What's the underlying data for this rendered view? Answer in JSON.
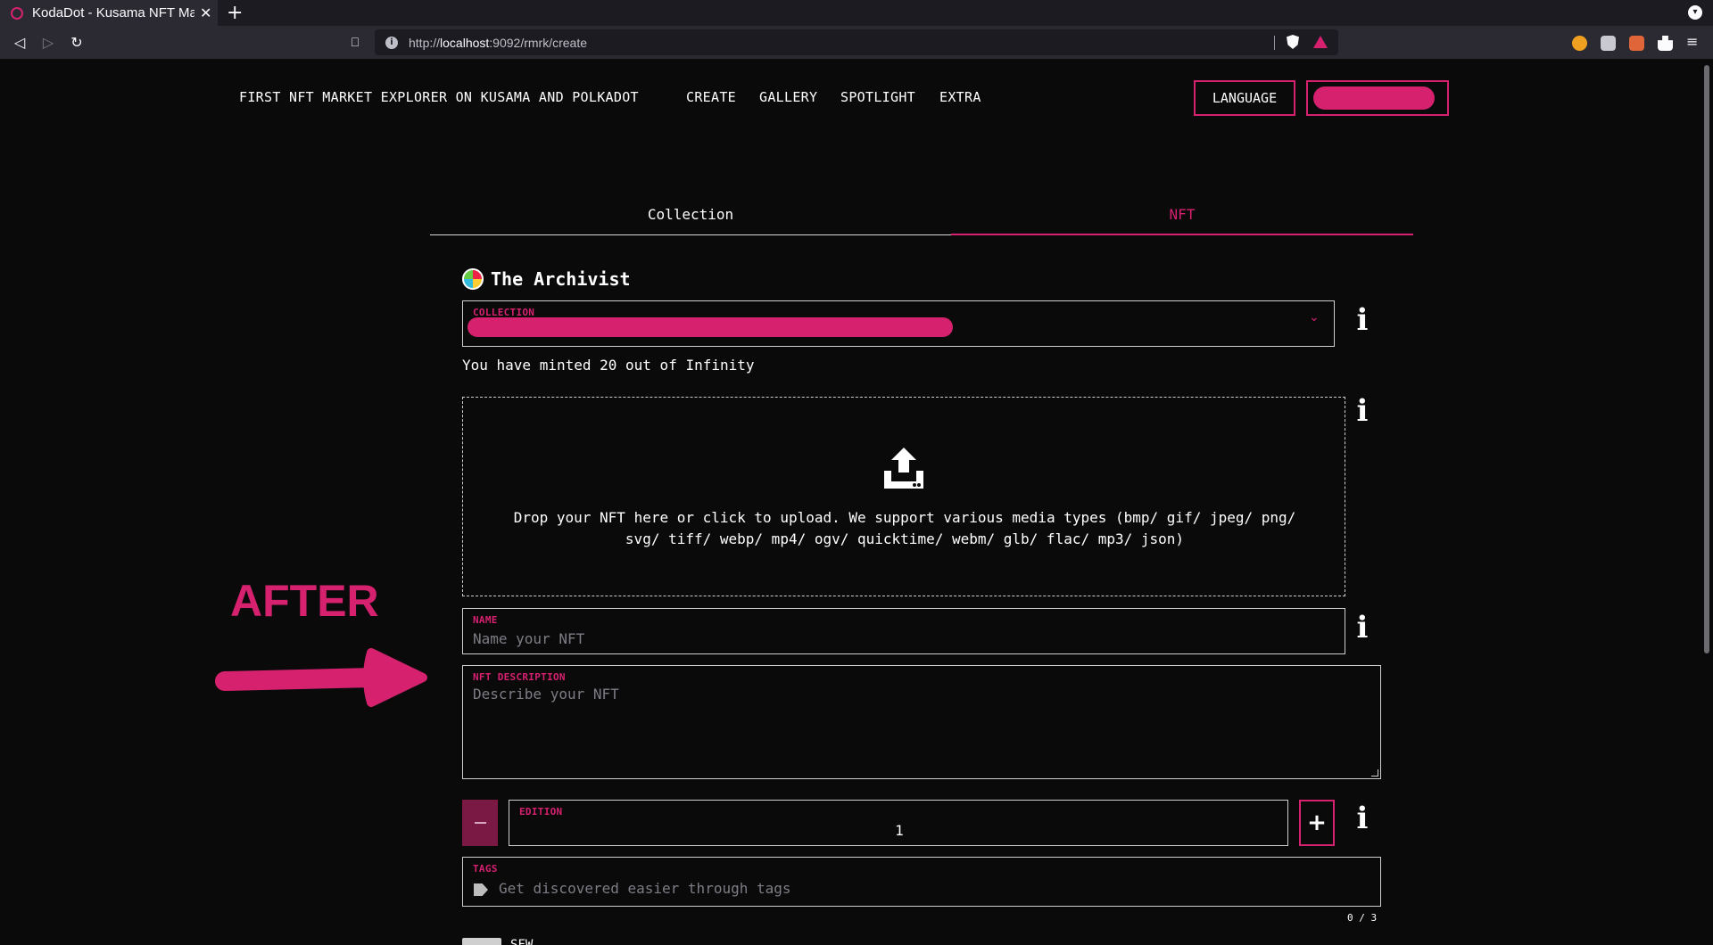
{
  "browser": {
    "tab_title": "KodaDot - Kusama NFT Market",
    "url_prefix": "http://",
    "url_host": "localhost",
    "url_path": ":9092/rmrk/create",
    "nav_back_icon": "back-arrow-icon",
    "nav_forward_icon": "forward-arrow-icon",
    "reload_icon": "reload-icon"
  },
  "header": {
    "logo_alt": "FIRST NFT MARKET EXPLORER ON KUSAMA AND POLKADOT",
    "nav": [
      "CREATE",
      "GALLERY",
      "SPOTLIGHT",
      "EXTRA"
    ],
    "language_label": "LANGUAGE"
  },
  "tabs": {
    "collection": "Collection",
    "nft": "NFT",
    "active": "NFT"
  },
  "owner": {
    "name": "The Archivist"
  },
  "form": {
    "collection_label": "COLLECTION",
    "minted_text": "You have minted 20 out of Infinity",
    "upload_text": "Drop your NFT here or click to upload. We support various media types (bmp/ gif/ jpeg/ png/ svg/ tiff/ webp/ mp4/ ogv/ quicktime/ webm/ glb/ flac/ mp3/ json)",
    "name_label": "NAME",
    "name_placeholder": "Name your NFT",
    "description_label": "NFT DESCRIPTION",
    "description_placeholder": "Describe your NFT",
    "edition_label": "EDITION",
    "edition_value": "1",
    "plus_label": "+",
    "tags_label": "TAGS",
    "tags_placeholder": "Get discovered easier through tags",
    "tags_counter": "0 / 3",
    "sfw_label": "SFW"
  },
  "annotation": {
    "text": "AFTER"
  },
  "colors": {
    "accent": "#d6216f",
    "background": "#0a0a0b"
  }
}
